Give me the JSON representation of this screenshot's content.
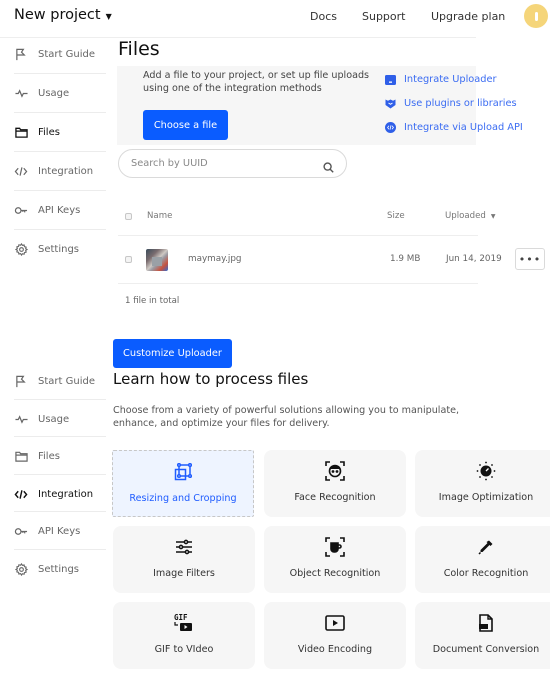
{
  "header": {
    "project_name": "New project",
    "links": [
      "Docs",
      "Support",
      "Upgrade plan"
    ],
    "avatar_color": "#f5d57a"
  },
  "sidebar": {
    "items": [
      {
        "label": "Start Guide",
        "icon": "flag-icon"
      },
      {
        "label": "Usage",
        "icon": "pulse-icon"
      },
      {
        "label": "Files",
        "icon": "folder-icon"
      },
      {
        "label": "Integration",
        "icon": "code-icon"
      },
      {
        "label": "API Keys",
        "icon": "key-icon"
      },
      {
        "label": "Settings",
        "icon": "gear-icon"
      }
    ],
    "active_top": "Files",
    "active_bottom": "Integration"
  },
  "files": {
    "title": "Files",
    "upload_text": "Add a file to your project, or set up file uploads using one of the integration methods",
    "choose_button": "Choose a file",
    "integration_links": [
      {
        "label": "Integrate Uploader",
        "icon": "uploader-icon"
      },
      {
        "label": "Use plugins or libraries",
        "icon": "plugin-icon"
      },
      {
        "label": "Integrate via Upload API",
        "icon": "api-icon"
      }
    ],
    "search_placeholder": "Search by UUID",
    "columns": {
      "name": "Name",
      "size": "Size",
      "uploaded": "Uploaded"
    },
    "rows": [
      {
        "name": "maymay.jpg",
        "size": "1.9 MB",
        "uploaded": "Jun 14, 2019"
      }
    ],
    "total": "1 file in total",
    "more_label": "•••"
  },
  "customize_button": "Customize Uploader",
  "learn": {
    "title": "Learn how to process files",
    "description": "Choose from a variety of powerful solutions allowing you to manipulate, enhance, and optimize your files for delivery.",
    "cards": [
      {
        "label": "Resizing and Cropping",
        "icon": "crop-icon",
        "selected": true
      },
      {
        "label": "Face Recognition",
        "icon": "face-icon"
      },
      {
        "label": "Image Optimization",
        "icon": "optimize-icon"
      },
      {
        "label": "Image Filters",
        "icon": "sliders-icon"
      },
      {
        "label": "Object Recognition",
        "icon": "object-icon"
      },
      {
        "label": "Color Recognition",
        "icon": "eyedropper-icon"
      },
      {
        "label": "GIF to VIdeo",
        "icon": "gif-video-icon"
      },
      {
        "label": "Video Encoding",
        "icon": "play-icon"
      },
      {
        "label": "Document Conversion",
        "icon": "document-icon"
      }
    ]
  },
  "accent_color": "#0a5cff",
  "link_color": "#3b6cf2"
}
